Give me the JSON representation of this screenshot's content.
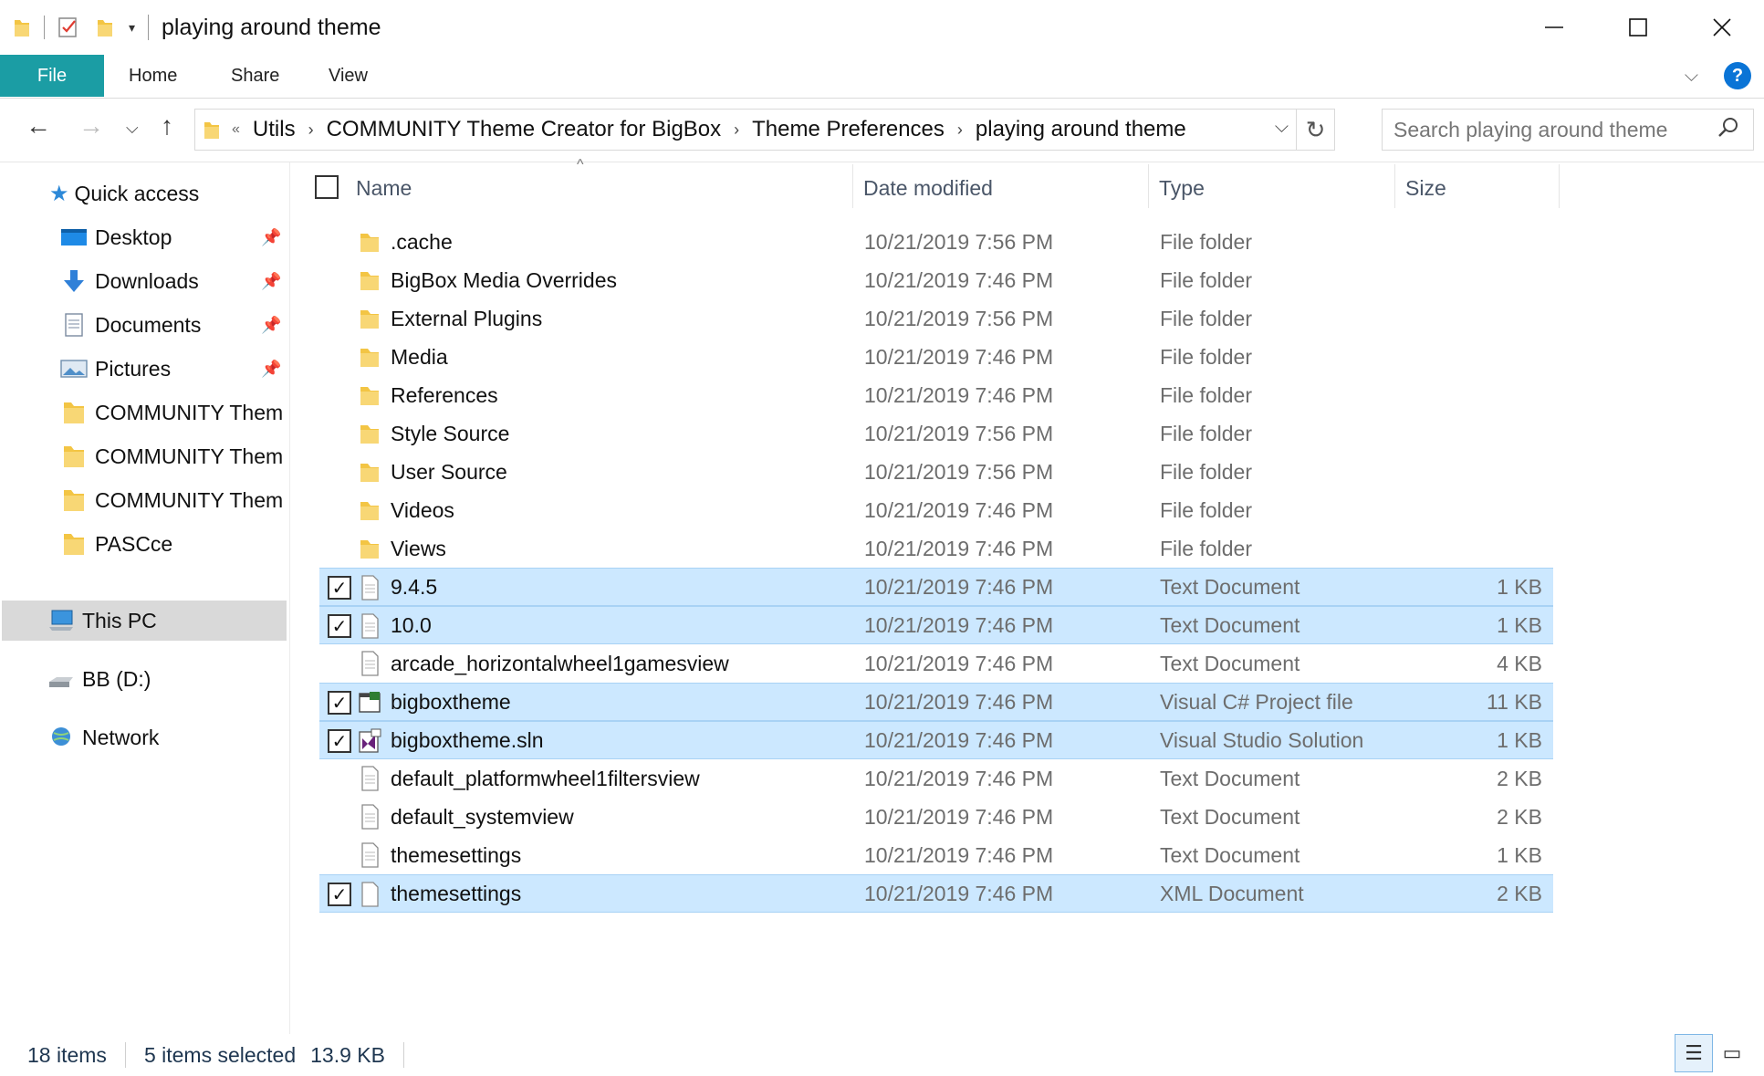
{
  "window": {
    "title": "playing around theme",
    "controls": [
      "minimize",
      "maximize",
      "close"
    ]
  },
  "quick_toolbar": {
    "dropdown": "▾"
  },
  "ribbon": {
    "tabs": [
      {
        "label": "File"
      },
      {
        "label": "Home"
      },
      {
        "label": "Share"
      },
      {
        "label": "View"
      }
    ],
    "help": "?"
  },
  "address": {
    "overflow": "«",
    "crumbs": [
      "Utils",
      "COMMUNITY Theme Creator for BigBox",
      "Theme Preferences",
      "playing around theme"
    ]
  },
  "search": {
    "placeholder": "Search playing around theme"
  },
  "sidebar": {
    "quick_access": "Quick access",
    "pinned": [
      {
        "label": "Desktop",
        "icon": "desktop-icon"
      },
      {
        "label": "Downloads",
        "icon": "downloads-icon"
      },
      {
        "label": "Documents",
        "icon": "documents-icon"
      },
      {
        "label": "Pictures",
        "icon": "pictures-icon"
      }
    ],
    "folders": [
      "COMMUNITY Them",
      "COMMUNITY Them",
      "COMMUNITY Them",
      "PASCce"
    ],
    "this_pc": "This PC",
    "drive": "BB (D:)",
    "network": "Network"
  },
  "columns": {
    "name": "Name",
    "date": "Date modified",
    "type": "Type",
    "size": "Size"
  },
  "files": [
    {
      "name": ".cache",
      "date": "10/21/2019 7:56 PM",
      "type": "File folder",
      "size": "",
      "kind": "folder",
      "selected": false
    },
    {
      "name": "BigBox Media Overrides",
      "date": "10/21/2019 7:46 PM",
      "type": "File folder",
      "size": "",
      "kind": "folder",
      "selected": false
    },
    {
      "name": "External Plugins",
      "date": "10/21/2019 7:56 PM",
      "type": "File folder",
      "size": "",
      "kind": "folder",
      "selected": false
    },
    {
      "name": "Media",
      "date": "10/21/2019 7:46 PM",
      "type": "File folder",
      "size": "",
      "kind": "folder",
      "selected": false
    },
    {
      "name": "References",
      "date": "10/21/2019 7:46 PM",
      "type": "File folder",
      "size": "",
      "kind": "folder",
      "selected": false
    },
    {
      "name": "Style Source",
      "date": "10/21/2019 7:56 PM",
      "type": "File folder",
      "size": "",
      "kind": "folder",
      "selected": false
    },
    {
      "name": "User Source",
      "date": "10/21/2019 7:56 PM",
      "type": "File folder",
      "size": "",
      "kind": "folder",
      "selected": false
    },
    {
      "name": "Videos",
      "date": "10/21/2019 7:46 PM",
      "type": "File folder",
      "size": "",
      "kind": "folder",
      "selected": false
    },
    {
      "name": "Views",
      "date": "10/21/2019 7:46 PM",
      "type": "File folder",
      "size": "",
      "kind": "folder",
      "selected": false
    },
    {
      "name": "9.4.5",
      "date": "10/21/2019 7:46 PM",
      "type": "Text Document",
      "size": "1 KB",
      "kind": "text",
      "selected": true
    },
    {
      "name": "10.0",
      "date": "10/21/2019 7:46 PM",
      "type": "Text Document",
      "size": "1 KB",
      "kind": "text",
      "selected": true
    },
    {
      "name": "arcade_horizontalwheel1gamesview",
      "date": "10/21/2019 7:46 PM",
      "type": "Text Document",
      "size": "4 KB",
      "kind": "text",
      "selected": false
    },
    {
      "name": "bigboxtheme",
      "date": "10/21/2019 7:46 PM",
      "type": "Visual C# Project file",
      "size": "11 KB",
      "kind": "csproj",
      "selected": true
    },
    {
      "name": "bigboxtheme.sln",
      "date": "10/21/2019 7:46 PM",
      "type": "Visual Studio Solution",
      "size": "1 KB",
      "kind": "sln",
      "selected": true
    },
    {
      "name": "default_platformwheel1filtersview",
      "date": "10/21/2019 7:46 PM",
      "type": "Text Document",
      "size": "2 KB",
      "kind": "text",
      "selected": false
    },
    {
      "name": "default_systemview",
      "date": "10/21/2019 7:46 PM",
      "type": "Text Document",
      "size": "2 KB",
      "kind": "text",
      "selected": false
    },
    {
      "name": "themesettings",
      "date": "10/21/2019 7:46 PM",
      "type": "Text Document",
      "size": "1 KB",
      "kind": "text",
      "selected": false
    },
    {
      "name": "themesettings",
      "date": "10/21/2019 7:46 PM",
      "type": "XML Document",
      "size": "2 KB",
      "kind": "xml",
      "selected": true
    }
  ],
  "status": {
    "items": "18 items",
    "selected": "5 items selected",
    "size": "13.9 KB"
  },
  "colors": {
    "accent": "#1b9da4",
    "selection": "#cce8ff",
    "folder": "#f8d775"
  }
}
